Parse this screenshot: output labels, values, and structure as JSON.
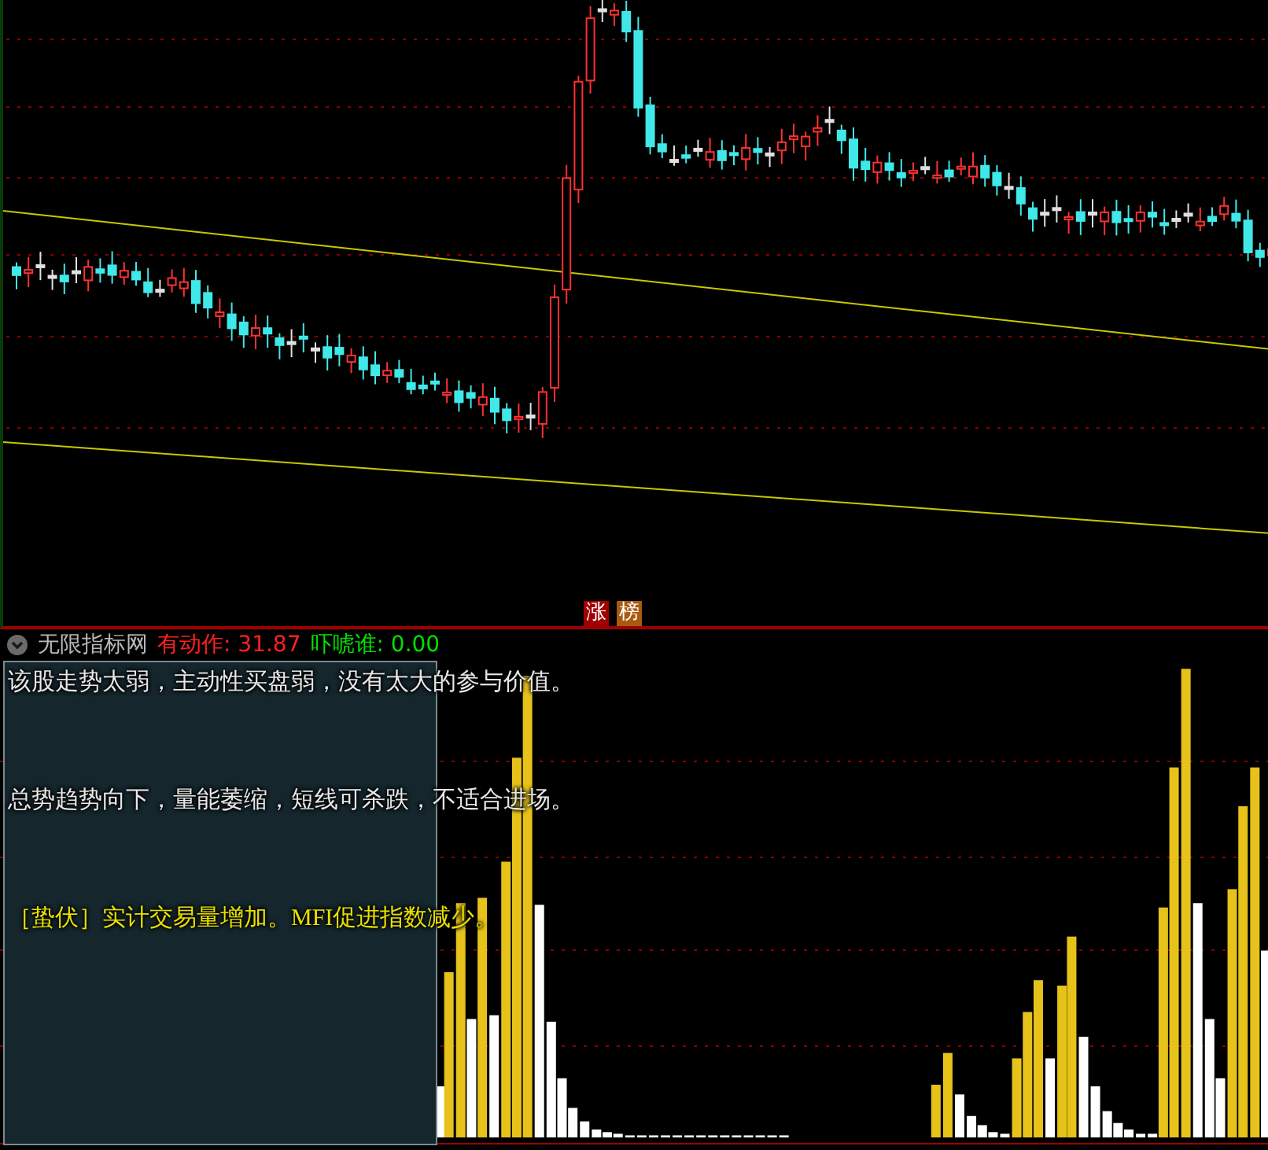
{
  "badges": [
    {
      "label": "涨",
      "color": "#a00000"
    },
    {
      "label": "榜",
      "color": "#a85a10"
    }
  ],
  "indicator_bar": {
    "title": "无限指标网",
    "values": [
      {
        "label": "有动作:",
        "value": "31.87",
        "color": "#ff2020"
      },
      {
        "label": "吓唬谁:",
        "value": "0.00",
        "color": "#00e000"
      }
    ]
  },
  "comment_panel": {
    "lines": [
      {
        "kind": "advice",
        "text": "该股走势太弱，主动性买盘弱，没有太大的参与价值。"
      },
      {
        "kind": "advice",
        "text": "总势趋势向下，量能萎缩，短线可杀跌，不适合进场。"
      },
      {
        "kind": "signal",
        "text": "［蛰伏］实计交易量增加。MFI促进指数减少。"
      }
    ]
  }
}
